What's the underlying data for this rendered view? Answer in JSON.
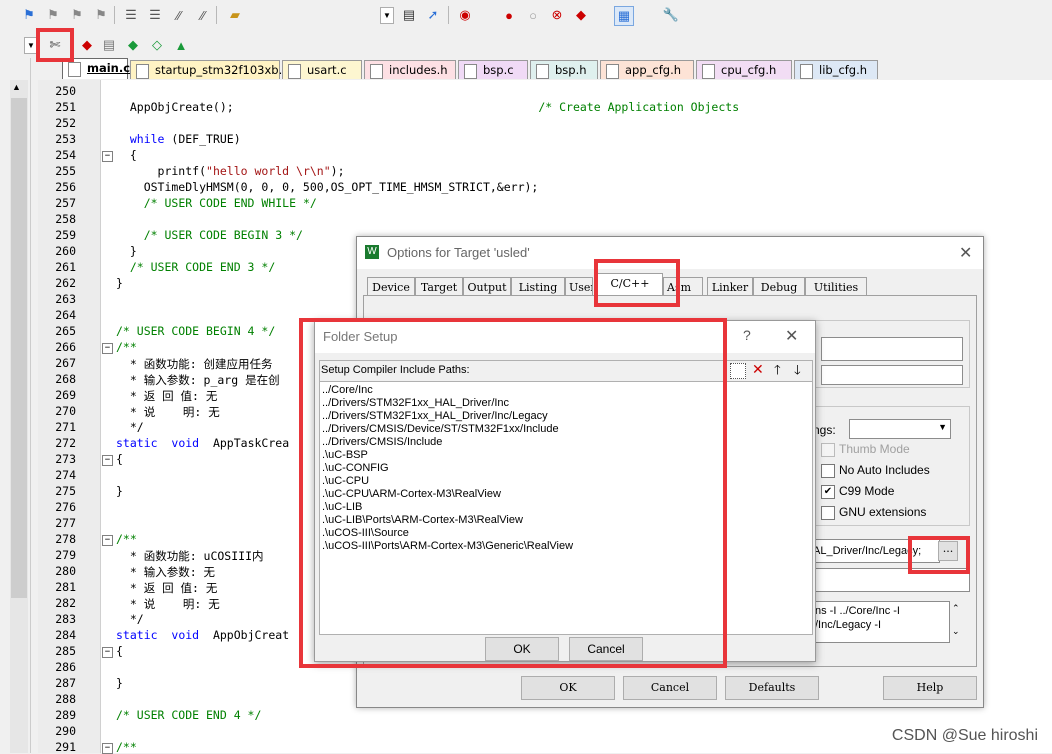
{
  "toolbar": {
    "row1_icons": [
      "flag-icon",
      "bookmark-prev-icon",
      "bookmark-next-icon",
      "bookmark-clear-icon",
      "indent-icon",
      "unindent-icon",
      "comment-icon",
      "uncomment-icon",
      "open-folder-icon",
      "dropdown-icon",
      "find-in-files-icon",
      "incremental-find-icon",
      "debug-icon",
      "breakpoint-icon",
      "disable-breakpoint-icon",
      "kill-breakpoints-icon",
      "window-icon",
      "wrench-icon"
    ],
    "row2_icons": [
      "target-options-icon",
      "manage-components-icon",
      "select-pack-icon",
      "runtime-env-icon",
      "pack-installer-icon",
      "validate-icon"
    ]
  },
  "tabs": [
    {
      "label": "main.c",
      "active": true,
      "color": "#ffffff"
    },
    {
      "label": "startup_stm32f103xb.s",
      "color": "#fff3c4"
    },
    {
      "label": "usart.c",
      "color": "#fdf6d0"
    },
    {
      "label": "includes.h",
      "color": "#fde0e4"
    },
    {
      "label": "bsp.c",
      "color": "#f0daf6"
    },
    {
      "label": "bsp.h",
      "color": "#dff0ee"
    },
    {
      "label": "app_cfg.h",
      "color": "#fde3d6"
    },
    {
      "label": "cpu_cfg.h",
      "color": "#f2ddf4"
    },
    {
      "label": "lib_cfg.h",
      "color": "#dde8f5"
    }
  ],
  "editor": {
    "lines": [
      {
        "n": "250",
        "text": "",
        "fold": ""
      },
      {
        "n": "251",
        "text": "  AppObjCreate();                                            /* Create Application Objects",
        "fold": ""
      },
      {
        "n": "252",
        "text": "",
        "fold": ""
      },
      {
        "n": "253",
        "text": "  while (DEF_TRUE)",
        "fold": ""
      },
      {
        "n": "254",
        "text": "  {",
        "fold": "−"
      },
      {
        "n": "255",
        "text": "      printf(\"hello world \\r\\n\");",
        "fold": ""
      },
      {
        "n": "256",
        "text": "    OSTimeDlyHMSM(0, 0, 0, 500,OS_OPT_TIME_HMSM_STRICT,&err);",
        "fold": ""
      },
      {
        "n": "257",
        "text": "    /* USER CODE END WHILE */",
        "fold": ""
      },
      {
        "n": "258",
        "text": "",
        "fold": ""
      },
      {
        "n": "259",
        "text": "    /* USER CODE BEGIN 3 */",
        "fold": ""
      },
      {
        "n": "260",
        "text": "  }",
        "fold": ""
      },
      {
        "n": "261",
        "text": "  /* USER CODE END 3 */",
        "fold": ""
      },
      {
        "n": "262",
        "text": "}",
        "fold": ""
      },
      {
        "n": "263",
        "text": "",
        "fold": ""
      },
      {
        "n": "264",
        "text": "",
        "fold": ""
      },
      {
        "n": "265",
        "text": "/* USER CODE BEGIN 4 */",
        "fold": ""
      },
      {
        "n": "266",
        "text": "/**",
        "fold": "−"
      },
      {
        "n": "267",
        "text": "  * 函数功能: 创建应用任务",
        "fold": ""
      },
      {
        "n": "268",
        "text": "  * 输入参数: p_arg 是在创",
        "fold": ""
      },
      {
        "n": "269",
        "text": "  * 返 回 值: 无",
        "fold": ""
      },
      {
        "n": "270",
        "text": "  * 说    明: 无",
        "fold": ""
      },
      {
        "n": "271",
        "text": "  */",
        "fold": ""
      },
      {
        "n": "272",
        "text": "static  void  AppTaskCrea",
        "fold": ""
      },
      {
        "n": "273",
        "text": "{",
        "fold": "−"
      },
      {
        "n": "274",
        "text": "",
        "fold": ""
      },
      {
        "n": "275",
        "text": "}",
        "fold": ""
      },
      {
        "n": "276",
        "text": "",
        "fold": ""
      },
      {
        "n": "277",
        "text": "",
        "fold": ""
      },
      {
        "n": "278",
        "text": "/**",
        "fold": "−"
      },
      {
        "n": "279",
        "text": "  * 函数功能: uCOSIII内",
        "fold": ""
      },
      {
        "n": "280",
        "text": "  * 输入参数: 无",
        "fold": ""
      },
      {
        "n": "281",
        "text": "  * 返 回 值: 无",
        "fold": ""
      },
      {
        "n": "282",
        "text": "  * 说    明: 无",
        "fold": ""
      },
      {
        "n": "283",
        "text": "  */",
        "fold": ""
      },
      {
        "n": "284",
        "text": "static  void  AppObjCreat",
        "fold": ""
      },
      {
        "n": "285",
        "text": "{",
        "fold": "−"
      },
      {
        "n": "286",
        "text": "",
        "fold": ""
      },
      {
        "n": "287",
        "text": "}",
        "fold": ""
      },
      {
        "n": "288",
        "text": "",
        "fold": ""
      },
      {
        "n": "289",
        "text": "/* USER CODE END 4 */",
        "fold": ""
      },
      {
        "n": "290",
        "text": "",
        "fold": ""
      },
      {
        "n": "291",
        "text": "/**",
        "fold": "−"
      }
    ]
  },
  "options_dialog": {
    "title": "Options for Target 'usled'",
    "tabs": [
      "Device",
      "Target",
      "Output",
      "Listing",
      "User",
      "C/C++",
      "Asm",
      "Linker",
      "Debug",
      "Utilities"
    ],
    "active_tab": "C/C++",
    "warnings_label": "ngs:",
    "checkboxes": [
      {
        "label": "Thumb Mode",
        "checked": false,
        "disabled": true
      },
      {
        "label": "No Auto Includes",
        "checked": false
      },
      {
        "label": "C99 Mode",
        "checked": true
      },
      {
        "label": "GNU extensions",
        "checked": false
      }
    ],
    "include_paths_value": "AL_Driver/Inc/Legacy;",
    "browse_label": "...",
    "misc_controls_text": [
      "ns -I ../Core/Inc -I",
      "/Inc/Legacy -I"
    ],
    "buttons": {
      "ok": "OK",
      "cancel": "Cancel",
      "defaults": "Defaults",
      "help": "Help"
    }
  },
  "folder_dialog": {
    "title": "Folder Setup",
    "help_glyph": "?",
    "close_glyph": "✕",
    "list_header": "Setup Compiler Include Paths:",
    "paths": [
      "../Core/Inc",
      "../Drivers/STM32F1xx_HAL_Driver/Inc",
      "../Drivers/STM32F1xx_HAL_Driver/Inc/Legacy",
      "../Drivers/CMSIS/Device/ST/STM32F1xx/Include",
      "../Drivers/CMSIS/Include",
      ".\\uC-BSP",
      ".\\uC-CONFIG",
      ".\\uC-CPU",
      ".\\uC-CPU\\ARM-Cortex-M3\\RealView",
      ".\\uC-LIB",
      ".\\uC-LIB\\Ports\\ARM-Cortex-M3\\RealView",
      ".\\uCOS-III\\Source",
      ".\\uCOS-III\\Ports\\ARM-Cortex-M3\\Generic\\RealView"
    ],
    "buttons": {
      "ok": "OK",
      "cancel": "Cancel"
    }
  },
  "watermark": "CSDN @Sue hiroshi",
  "highlight_color": "#e8353a"
}
